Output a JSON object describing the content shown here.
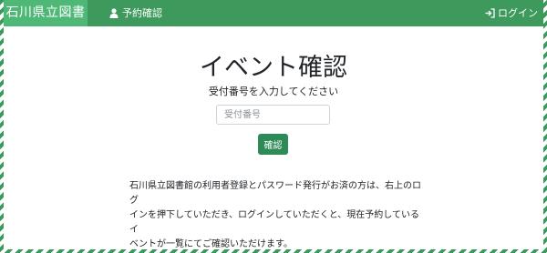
{
  "navbar": {
    "brand": "石川県立図書館",
    "reserve_label": "予約確認",
    "login_label": "ログイン",
    "icons": {
      "reserve": "user-icon",
      "login": "sign-in-icon"
    },
    "colors": {
      "bar": "#3d9a5c",
      "brand_bg": "#4fb877"
    }
  },
  "main": {
    "title": "イベント確認",
    "subtitle": "受付番号を入力してください",
    "input_placeholder": "受付番号",
    "confirm_label": "確認",
    "info_lines": [
      "石川県立図書館の利用者登録とパスワード発行がお済の方は、右上のログ",
      "インを押下していただき、ログインしていただくと、現在予約しているイ",
      "ベントが一覧にてご確認いただけます。"
    ],
    "colors": {
      "button": "#2e8b57"
    }
  }
}
